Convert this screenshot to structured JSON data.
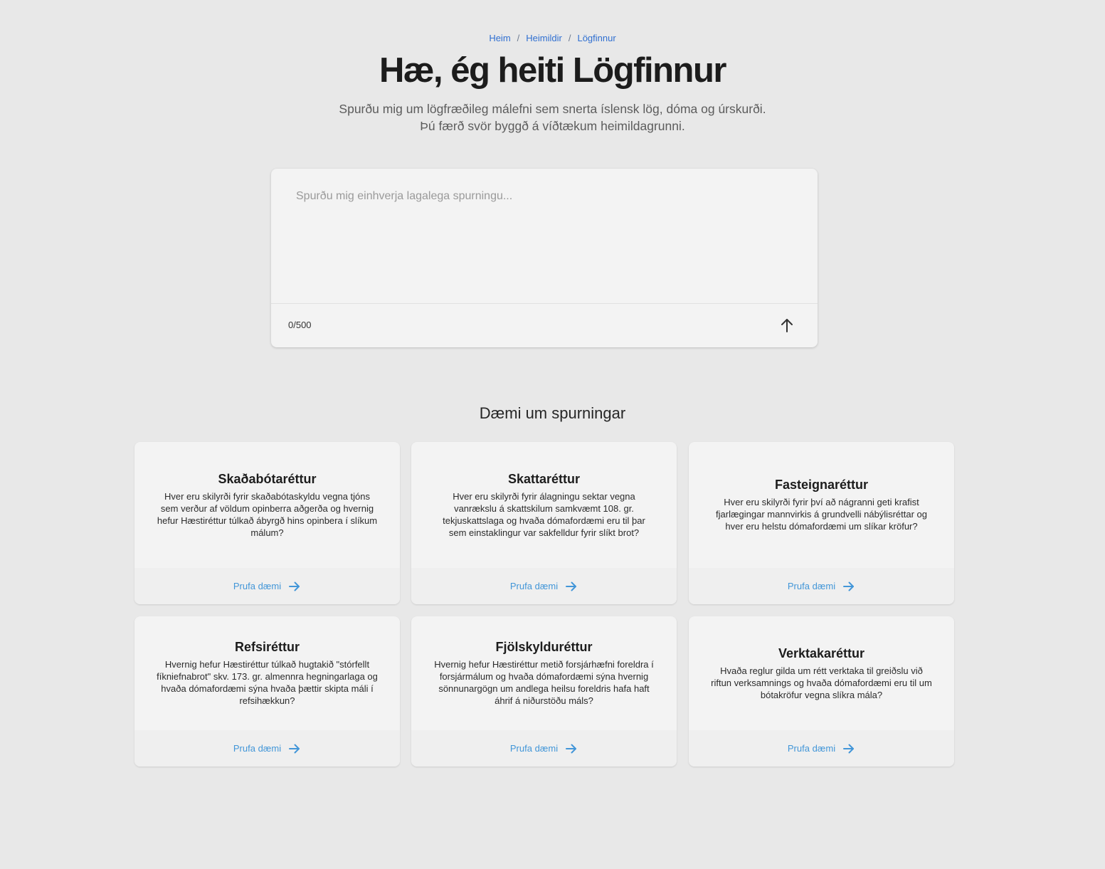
{
  "breadcrumb": {
    "items": [
      "Heim",
      "Heimildir",
      "Lögfinnur"
    ],
    "separator": "/"
  },
  "hero": {
    "title": "Hæ, ég heiti Lögfinnur",
    "subtitle_line1": "Spurðu mig um lögfræðileg málefni sem snerta íslensk lög, dóma og úrskurði.",
    "subtitle_line2": "Þú færð svör byggð á víðtækum heimildagrunni."
  },
  "query": {
    "placeholder": "Spurðu mig einhverja lagalega spurningu...",
    "value": "",
    "char_count": "0/500",
    "send_icon": "arrow-up-icon"
  },
  "examples": {
    "heading": "Dæmi um spurningar",
    "link_label": "Prufa dæmi",
    "link_icon": "arrow-right-icon",
    "cards": [
      {
        "title": "Skaðabótaréttur",
        "question": "Hver eru skilyrði fyrir skaðabótaskyldu vegna tjóns sem verður af völdum opinberra aðgerða og hvernig hefur Hæstiréttur túlkað ábyrgð hins opinbera í slíkum málum?"
      },
      {
        "title": "Skattaréttur",
        "question": "Hver eru skilyrði fyrir álagningu sektar vegna vanrækslu á skattskilum samkvæmt 108. gr. tekjuskattslaga og hvaða dómafordæmi eru til þar sem einstaklingur var sakfelldur fyrir slíkt brot?"
      },
      {
        "title": "Fasteignaréttur",
        "question": "Hver eru skilyrði fyrir því að nágranni geti krafist fjarlægingar mannvirkis á grundvelli nábýlisréttar og hver eru helstu dómafordæmi um slíkar kröfur?"
      },
      {
        "title": "Refsiréttur",
        "question": "Hvernig hefur Hæstiréttur túlkað hugtakið \"stórfellt fíkniefnabrot\" skv. 173. gr. almennra hegningarlaga og hvaða dómafordæmi sýna hvaða þættir skipta máli í refsihækkun?"
      },
      {
        "title": "Fjölskylduréttur",
        "question": "Hvernig hefur Hæstiréttur metið forsjárhæfni foreldra í forsjármálum og hvaða dómafordæmi sýna hvernig sönnunargögn um andlega heilsu foreldris hafa haft áhrif á niðurstöðu máls?"
      },
      {
        "title": "Verktakaréttur",
        "question": "Hvaða reglur gilda um rétt verktaka til greiðslu við riftun verksamnings og hvaða dómafordæmi eru til um bótakröfur vegna slíkra mála?"
      }
    ]
  },
  "colors": {
    "background": "#e8e8e8",
    "card": "#f3f3f3",
    "link": "#4296d8",
    "breadcrumb": "#2f6fd1"
  }
}
